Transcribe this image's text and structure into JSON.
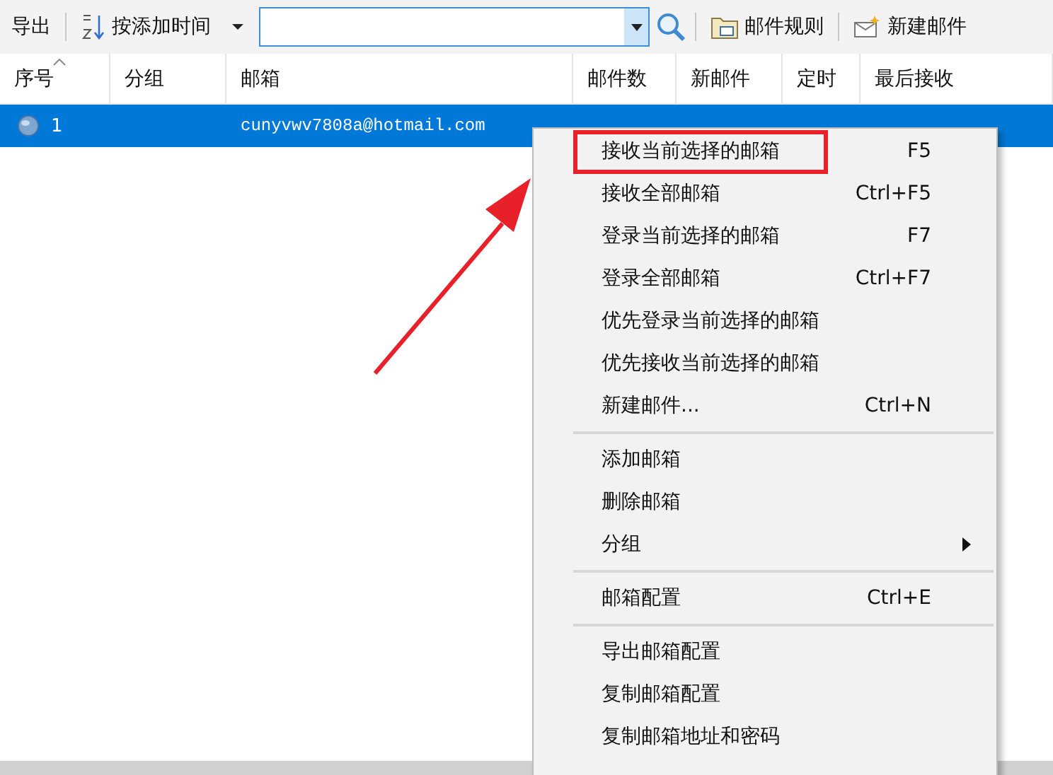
{
  "toolbar": {
    "export_button": "导出",
    "sort_button": "按添加时间",
    "rules_button": "邮件规则",
    "new_mail_button": "新建邮件"
  },
  "table": {
    "columns": [
      "序号",
      "分组",
      "邮箱",
      "邮件数",
      "新邮件",
      "定时",
      "最后接收"
    ],
    "rows": [
      {
        "selected": true,
        "cells": [
          "1",
          "",
          "cunyvwv7808a@hotmail.com",
          "",
          "",
          "",
          ""
        ]
      }
    ]
  },
  "context_menu": {
    "items": [
      {
        "kind": "item",
        "label": "接收当前选择的邮箱",
        "shortcut": "F5",
        "highlighted": true
      },
      {
        "kind": "item",
        "label": "接收全部邮箱",
        "shortcut": "Ctrl+F5",
        "highlighted": false
      },
      {
        "kind": "item",
        "label": "登录当前选择的邮箱",
        "shortcut": "F7",
        "highlighted": false
      },
      {
        "kind": "item",
        "label": "登录全部邮箱",
        "shortcut": "Ctrl+F7",
        "highlighted": false
      },
      {
        "kind": "item",
        "label": "优先登录当前选择的邮箱",
        "highlighted": false
      },
      {
        "kind": "item",
        "label": "优先接收当前选择的邮箱",
        "highlighted": false
      },
      {
        "kind": "item",
        "label": "新建邮件...",
        "shortcut": "Ctrl+N",
        "highlighted": false
      },
      {
        "kind": "separator"
      },
      {
        "kind": "item",
        "label": "添加邮箱",
        "highlighted": false
      },
      {
        "kind": "item",
        "label": "删除邮箱",
        "highlighted": false
      },
      {
        "kind": "submenu",
        "label": "分组",
        "highlighted": false
      },
      {
        "kind": "separator"
      },
      {
        "kind": "item",
        "label": "邮箱配置",
        "shortcut": "Ctrl+E",
        "highlighted": false
      },
      {
        "kind": "separator"
      },
      {
        "kind": "item",
        "label": "导出邮箱配置",
        "highlighted": false
      },
      {
        "kind": "item",
        "label": "复制邮箱配置",
        "highlighted": false
      },
      {
        "kind": "item",
        "label": "复制邮箱地址和密码",
        "highlighted": false
      }
    ]
  }
}
